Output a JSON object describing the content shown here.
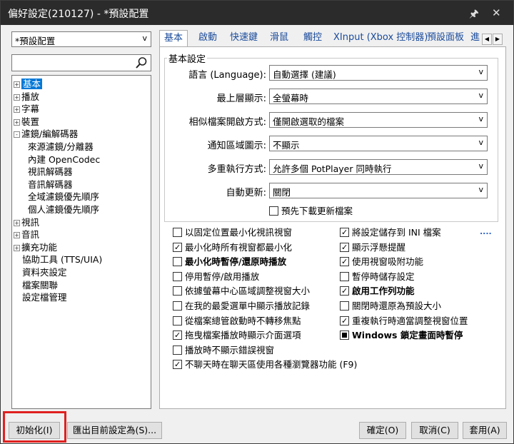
{
  "window": {
    "title": "偏好設定(210127) - *預設配置",
    "pin_icon": "pin-icon",
    "close_icon": "close-icon"
  },
  "sidebar": {
    "preset_value": "*預設配置",
    "preset_arrow": "v",
    "tree": [
      {
        "label": "基本",
        "expander": "+",
        "selected": true
      },
      {
        "label": "播放",
        "expander": "+"
      },
      {
        "label": "字幕",
        "expander": "+"
      },
      {
        "label": "裝置",
        "expander": "+"
      },
      {
        "label": "濾鏡/編解碼器",
        "expander": "-"
      },
      {
        "label": "來源濾鏡/分離器"
      },
      {
        "label": "內建 OpenCodec"
      },
      {
        "label": "視訊解碼器"
      },
      {
        "label": "音訊解碼器"
      },
      {
        "label": "全域濾鏡優先順序"
      },
      {
        "label": "個人濾鏡優先順序"
      },
      {
        "label": "視訊",
        "expander": "+"
      },
      {
        "label": "音訊",
        "expander": "+"
      },
      {
        "label": "擴充功能",
        "expander": "+"
      },
      {
        "label": "協助工具 (TTS/UIA)"
      },
      {
        "label": "資料夾設定"
      },
      {
        "label": "檔案關聯"
      },
      {
        "label": "設定檔管理"
      }
    ]
  },
  "tabs": [
    "基本",
    "啟動",
    "快速鍵",
    "滑鼠",
    "觸控",
    "XInput (Xbox 控制器)",
    "預設面板",
    "進"
  ],
  "tab_scroll": [
    "◀",
    "▶"
  ],
  "basic": {
    "group_title": "基本設定",
    "fields": [
      {
        "label": "語言 (Language):",
        "value": "自動選擇 (建議)"
      },
      {
        "label": "最上層顯示:",
        "value": "全螢幕時"
      },
      {
        "label": "相似檔案開啟方式:",
        "value": "僅開啟選取的檔案"
      },
      {
        "label": "通知區域圖示:",
        "value": "不顯示"
      },
      {
        "label": "多重執行方式:",
        "value": "允許多個 PotPlayer 同時執行"
      },
      {
        "label": "自動更新:",
        "value": "關閉"
      }
    ],
    "combo_arrow": "v",
    "predownload": "預先下載更新檔案"
  },
  "options_left": [
    {
      "label": "以固定位置最小化視訊視窗",
      "checked": false
    },
    {
      "label": "最小化時所有視窗都最小化",
      "checked": true
    },
    {
      "label": "最小化時暫停/還原時播放",
      "checked": false,
      "bold": true
    },
    {
      "label": "停用暫停/啟用播放",
      "checked": false
    },
    {
      "label": "依據螢幕中心區域調整視窗大小",
      "checked": false
    },
    {
      "label": "在我的最愛選單中顯示播放記錄",
      "checked": false
    },
    {
      "label": "從檔案總管啟動時不轉移焦點",
      "checked": false
    },
    {
      "label": "拖曳檔案播放時顯示介面選項",
      "checked": true
    },
    {
      "label": "播放時不顯示錯誤視窗",
      "checked": false
    },
    {
      "label": "不聊天時在聊天區使用各種瀏覽器功能 (F9)",
      "checked": true
    }
  ],
  "options_right": [
    {
      "label": "將設定儲存到 INI 檔案",
      "checked": true
    },
    {
      "label": "顯示浮懸提醒",
      "checked": true
    },
    {
      "label": "使用視窗吸附功能",
      "checked": true
    },
    {
      "label": "暫停時儲存設定",
      "checked": false
    },
    {
      "label": "啟用工作列功能",
      "checked": true,
      "bold": true
    },
    {
      "label": "關閉時還原為預設大小",
      "checked": false
    },
    {
      "label": "重複執行時適當調整視窗位置",
      "checked": true
    },
    {
      "label": "Windows 鎖定畫面時暫停",
      "checked": "indeterminate",
      "bold": true
    }
  ],
  "ini_more": "....",
  "buttons": {
    "reset": "初始化(I)",
    "export": "匯出目前設定為(S)...",
    "ok": "確定(O)",
    "cancel": "取消(C)",
    "apply": "套用(A)"
  }
}
